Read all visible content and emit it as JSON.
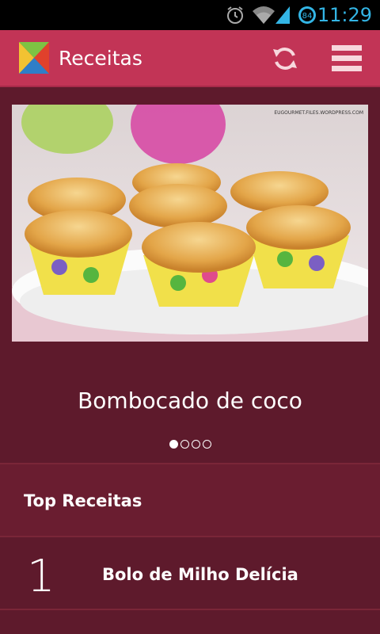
{
  "status_bar": {
    "time": "11:29",
    "battery_level": "84",
    "icons": [
      "alarm-icon",
      "wifi-icon",
      "signal-icon",
      "battery-icon"
    ],
    "time_color": "#33b5e5"
  },
  "action_bar": {
    "title": "Receitas",
    "logo_icon": "app-logo-icon",
    "actions": [
      "refresh-icon",
      "menu-icon"
    ],
    "background_color": "#c23456"
  },
  "carousel": {
    "image_watermark": "EUGOURMET.FILES.WORDPRESS.COM",
    "title": "Bombocado de coco",
    "page_count": 4,
    "current_page": 1
  },
  "top_recipes": {
    "header": "Top Receitas",
    "items": [
      {
        "rank": "1",
        "name": "Bolo de Milho Delícia"
      }
    ]
  },
  "colors": {
    "background": "#5e1a2c",
    "accent": "#c23456"
  }
}
